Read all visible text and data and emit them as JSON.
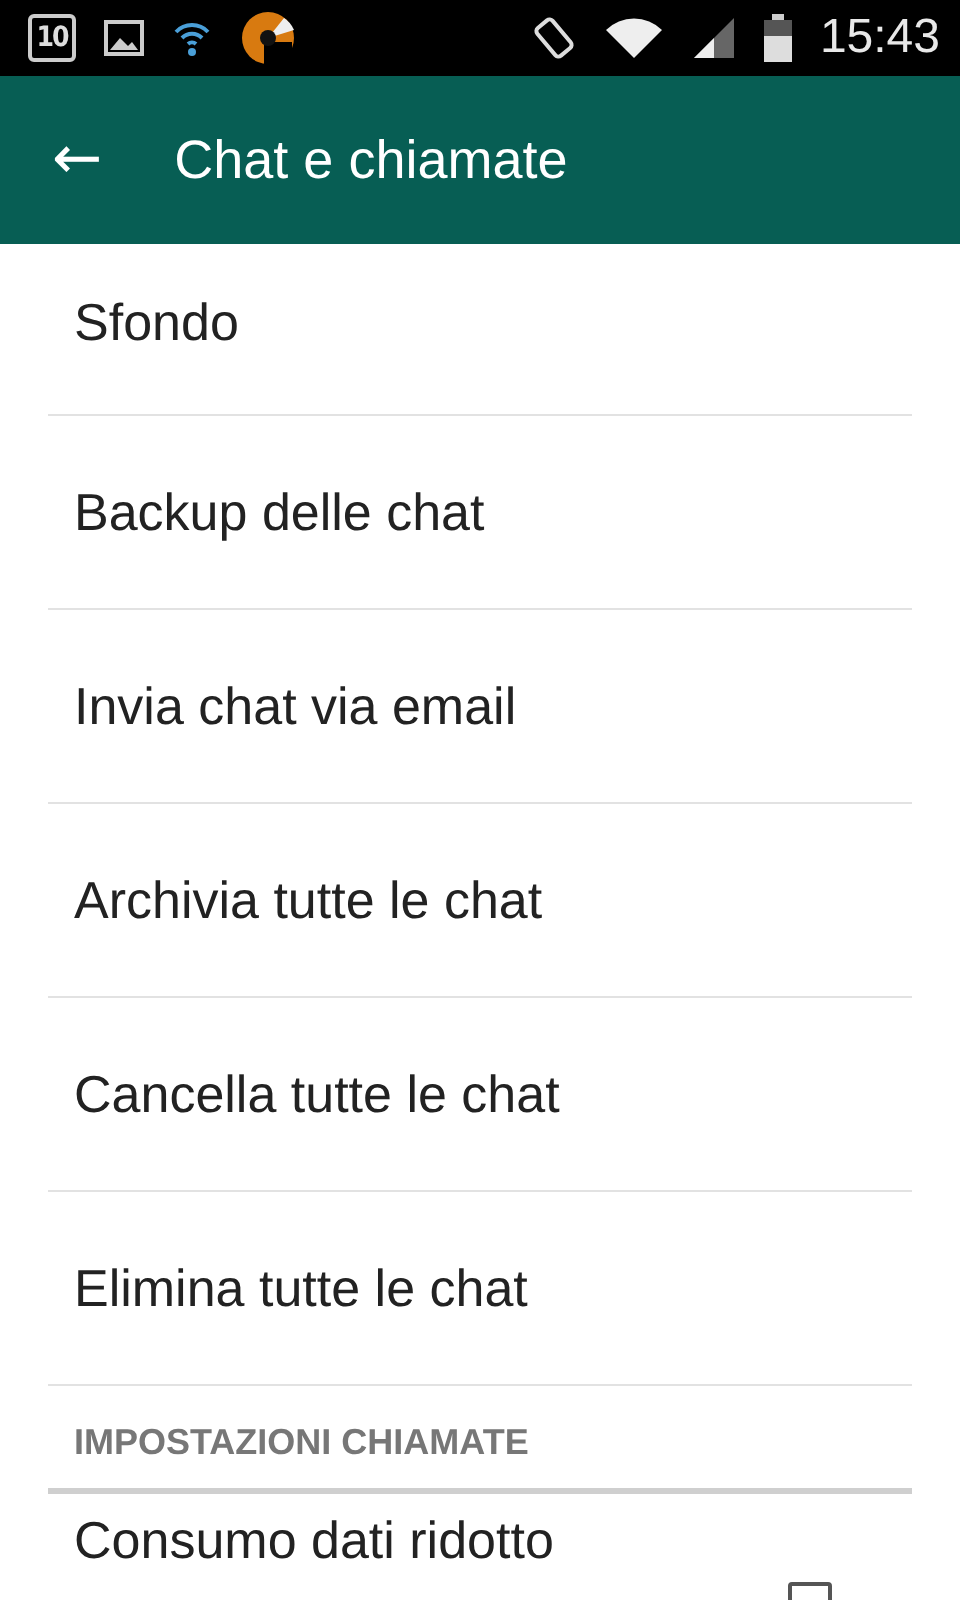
{
  "status_bar": {
    "calendar_day": "10",
    "time": "15:43"
  },
  "app_bar": {
    "back_icon": "←",
    "title": "Chat e chiamate"
  },
  "items": [
    {
      "label": "Sfondo"
    },
    {
      "label": "Backup delle chat"
    },
    {
      "label": "Invia chat via email"
    },
    {
      "label": "Archivia tutte le chat"
    },
    {
      "label": "Cancella tutte le chat"
    },
    {
      "label": "Elimina tutte le chat"
    }
  ],
  "section": {
    "header": "IMPOSTAZIONI CHIAMATE",
    "items": [
      {
        "label": "Consumo dati ridotto",
        "checked": false
      }
    ]
  }
}
